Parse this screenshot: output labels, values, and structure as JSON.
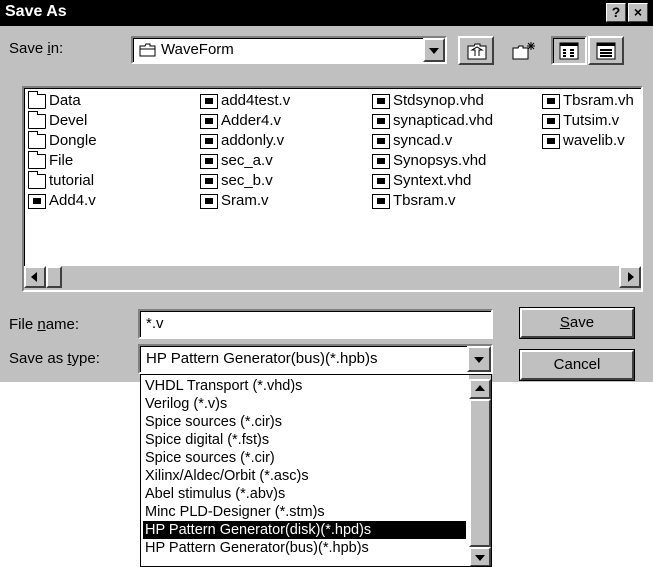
{
  "window": {
    "title": "Save As",
    "help_label": "?",
    "close_label": "×"
  },
  "save_in": {
    "label_pre": "Save ",
    "label_u": "i",
    "label_post": "n:",
    "value": "WaveForm"
  },
  "files": {
    "col1": [
      {
        "name": "Data",
        "type": "folder"
      },
      {
        "name": "Devel",
        "type": "folder"
      },
      {
        "name": "Dongle",
        "type": "folder"
      },
      {
        "name": "File",
        "type": "folder"
      },
      {
        "name": "tutorial",
        "type": "folder"
      },
      {
        "name": "Add4.v",
        "type": "file"
      }
    ],
    "col2": [
      {
        "name": "add4test.v",
        "type": "file"
      },
      {
        "name": "Adder4.v",
        "type": "file"
      },
      {
        "name": "addonly.v",
        "type": "file"
      },
      {
        "name": "sec_a.v",
        "type": "file"
      },
      {
        "name": "sec_b.v",
        "type": "file"
      },
      {
        "name": "Sram.v",
        "type": "file"
      }
    ],
    "col3": [
      {
        "name": "Stdsynop.vhd",
        "type": "file"
      },
      {
        "name": "synapticad.vhd",
        "type": "file"
      },
      {
        "name": "syncad.v",
        "type": "file"
      },
      {
        "name": "Synopsys.vhd",
        "type": "file"
      },
      {
        "name": "Syntext.vhd",
        "type": "file"
      },
      {
        "name": "Tbsram.v",
        "type": "file"
      }
    ],
    "col4": [
      {
        "name": "Tbsram.vh",
        "type": "file"
      },
      {
        "name": "Tutsim.v",
        "type": "file"
      },
      {
        "name": "wavelib.v",
        "type": "file"
      }
    ]
  },
  "file_name": {
    "label_pre": "File ",
    "label_u": "n",
    "label_post": "ame:",
    "value": "*.v"
  },
  "save_as_type": {
    "label_pre": "Save as ",
    "label_u": "t",
    "label_post": "ype:",
    "value": "HP Pattern Generator(bus)(*.hpb)s"
  },
  "buttons": {
    "save_u": "S",
    "save_rest": "ave",
    "cancel": "Cancel"
  },
  "dropdown_options": [
    "VHDL Transport (*.vhd)s",
    "Verilog (*.v)s",
    "Spice sources (*.cir)s",
    "Spice digital (*.fst)s",
    "Spice sources (*.cir)",
    "Xilinx/Aldec/Orbit (*.asc)s",
    "Abel stimulus (*.abv)s",
    "Minc PLD-Designer (*.stm)s",
    "HP Pattern Generator(disk)(*.hpd)s",
    "HP Pattern Generator(bus)(*.hpb)s"
  ],
  "dropdown_selected_index": 8,
  "icons": {
    "folder": "folder-icon",
    "file": "document-icon",
    "up": "up-folder-icon",
    "new": "new-folder-icon",
    "list": "list-view-icon",
    "details": "details-view-icon"
  }
}
